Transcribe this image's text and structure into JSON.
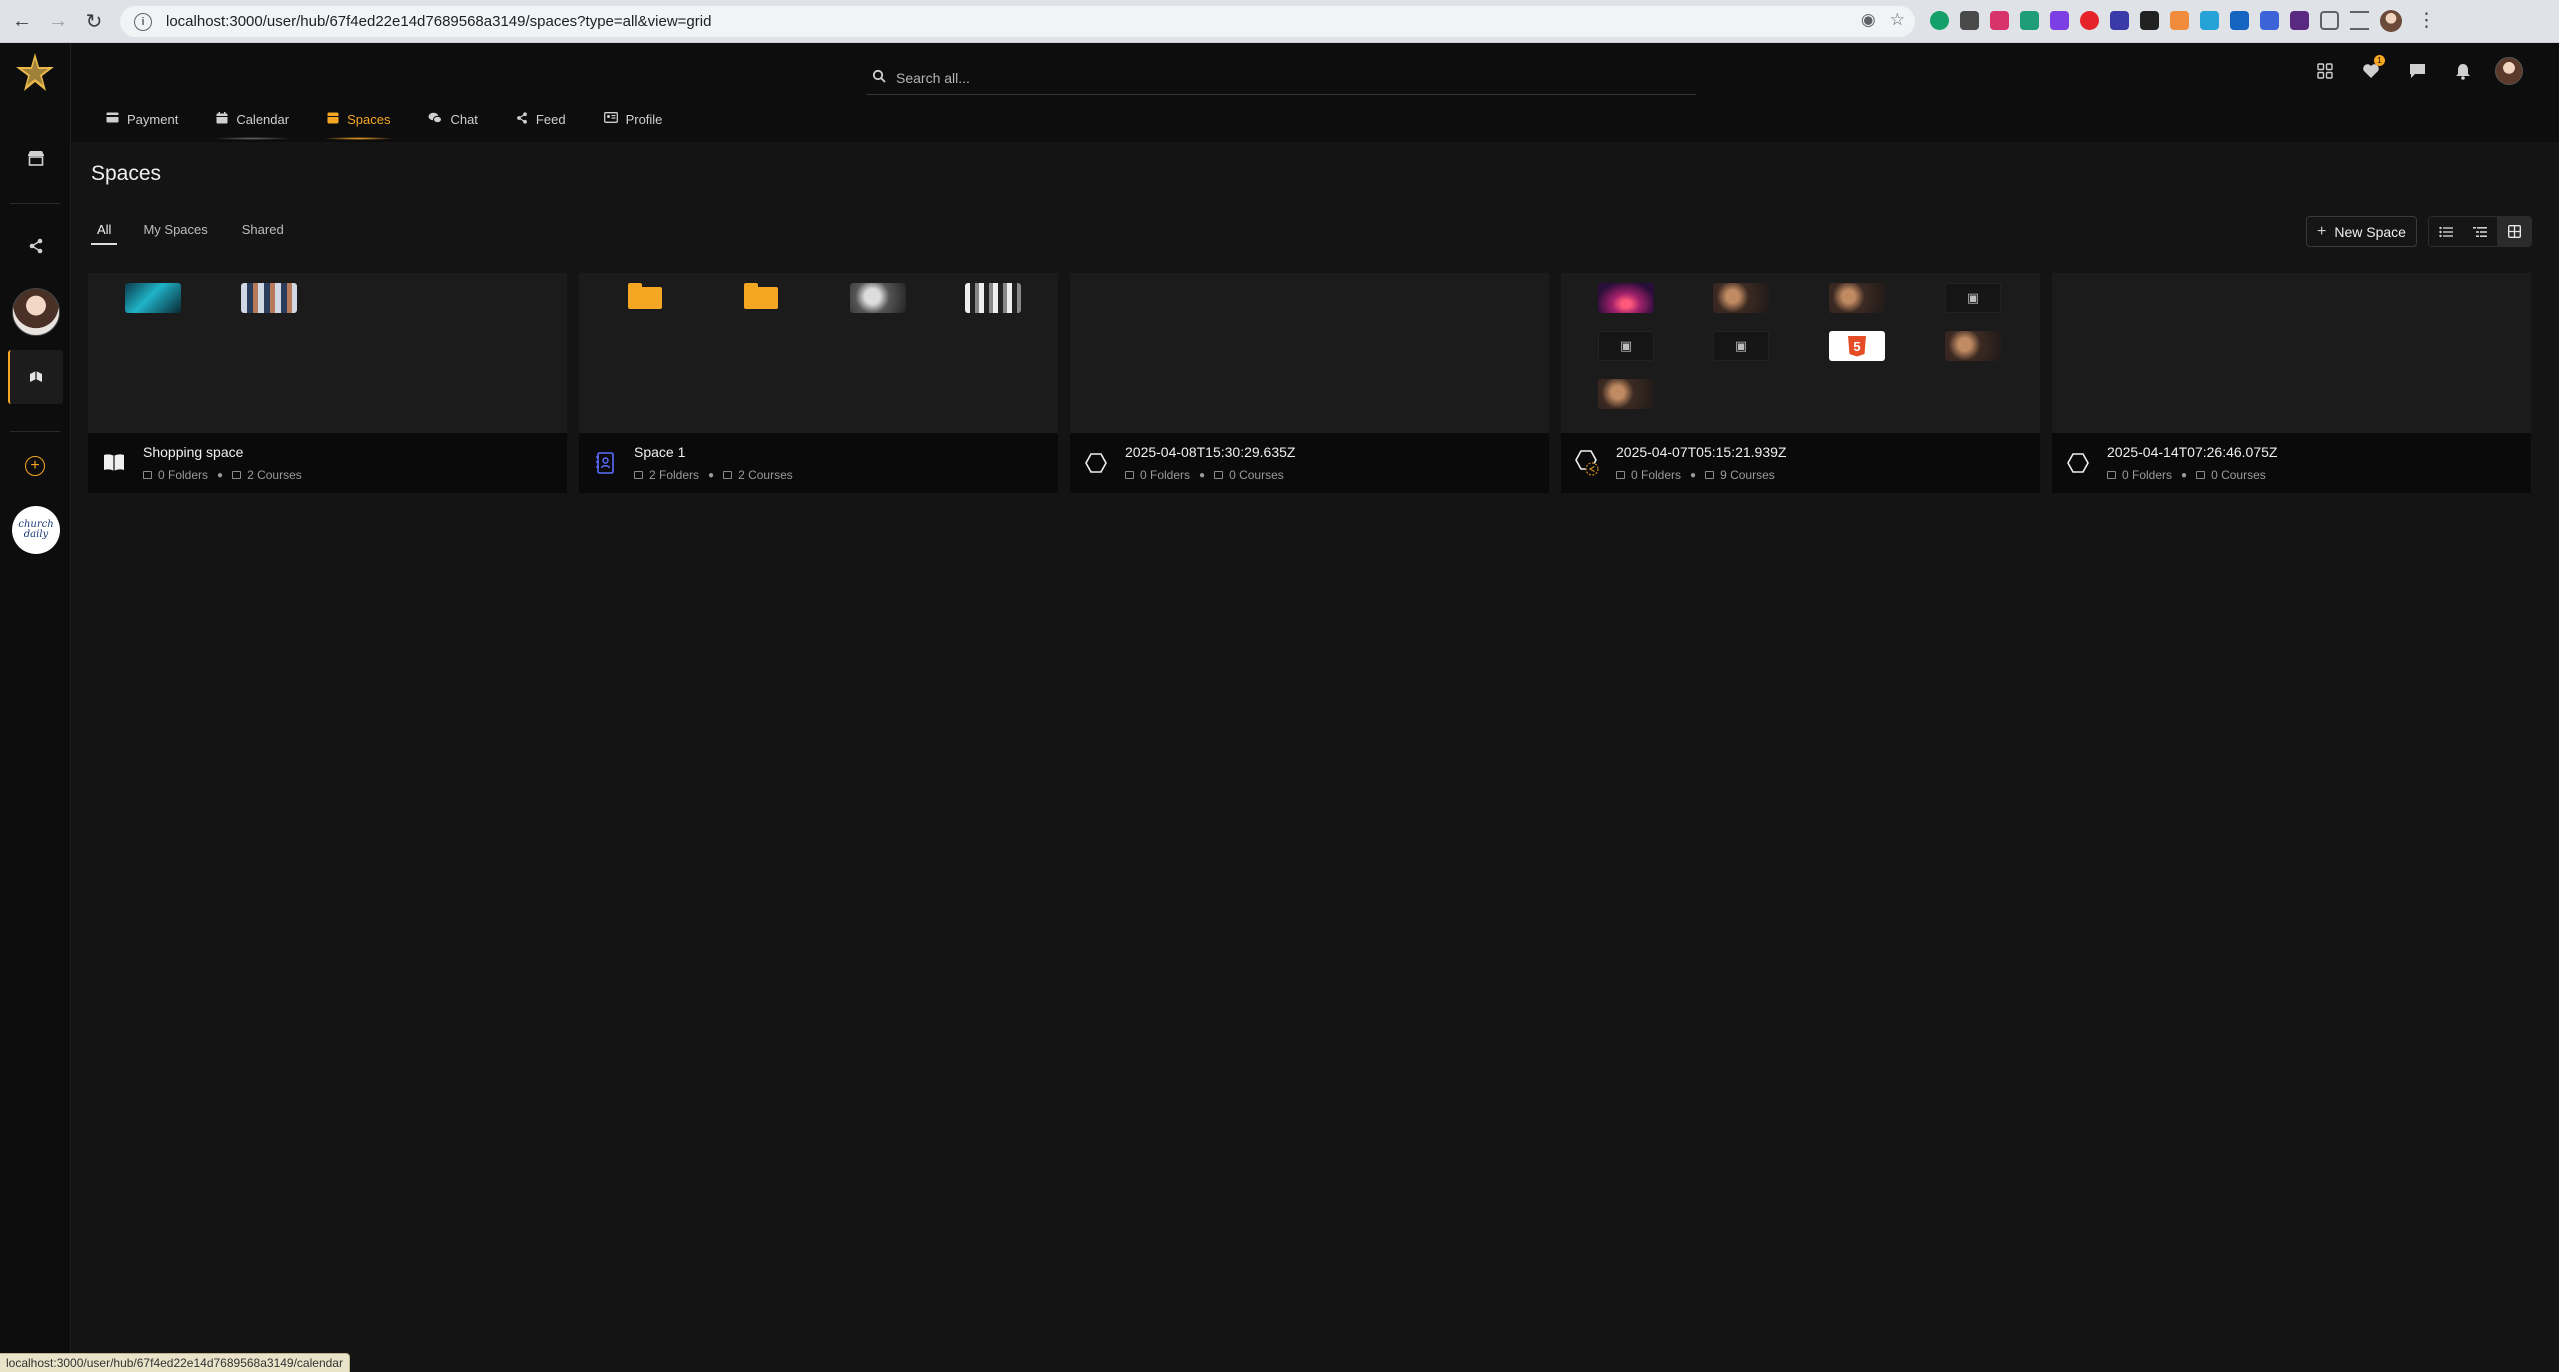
{
  "browser": {
    "url": "localhost:3000/user/hub/67f4ed22e14d7689568a3149/spaces?type=all&view=grid",
    "status_url": "localhost:3000/user/hub/67f4ed22e14d7689568a3149/calendar"
  },
  "header": {
    "search_placeholder": "Search all...",
    "likes_badge": "1"
  },
  "tabs": [
    {
      "label": "Payment",
      "icon": "credit-card-icon"
    },
    {
      "label": "Calendar",
      "icon": "calendar-icon"
    },
    {
      "label": "Spaces",
      "icon": "spaces-icon",
      "active": true
    },
    {
      "label": "Chat",
      "icon": "chat-icon"
    },
    {
      "label": "Feed",
      "icon": "share-icon"
    },
    {
      "label": "Profile",
      "icon": "id-card-icon"
    }
  ],
  "page": {
    "title": "Spaces",
    "filters": [
      "All",
      "My Spaces",
      "Shared"
    ],
    "active_filter": "All",
    "new_space_label": "New Space",
    "view": "grid"
  },
  "spaces": [
    {
      "name": "Shopping space",
      "folders": "0 Folders",
      "courses": "2 Courses",
      "icon": "book-icon"
    },
    {
      "name": "Space 1",
      "folders": "2 Folders",
      "courses": "2 Courses",
      "icon": "contact-book-icon"
    },
    {
      "name": "2025-04-08T15:30:29.635Z",
      "folders": "0 Folders",
      "courses": "0 Courses",
      "icon": "hexagon-icon"
    },
    {
      "name": "2025-04-07T05:15:21.939Z",
      "folders": "0 Folders",
      "courses": "9 Courses",
      "icon": "hexagon-icon"
    },
    {
      "name": "2025-04-14T07:26:46.075Z",
      "folders": "0 Folders",
      "courses": "0 Courses",
      "icon": "hexagon-icon"
    }
  ],
  "rail": {
    "church_logo_text": "church daily"
  },
  "colors": {
    "accent": "#f5a623",
    "background": "#141414",
    "surface": "#0d0d0d"
  }
}
